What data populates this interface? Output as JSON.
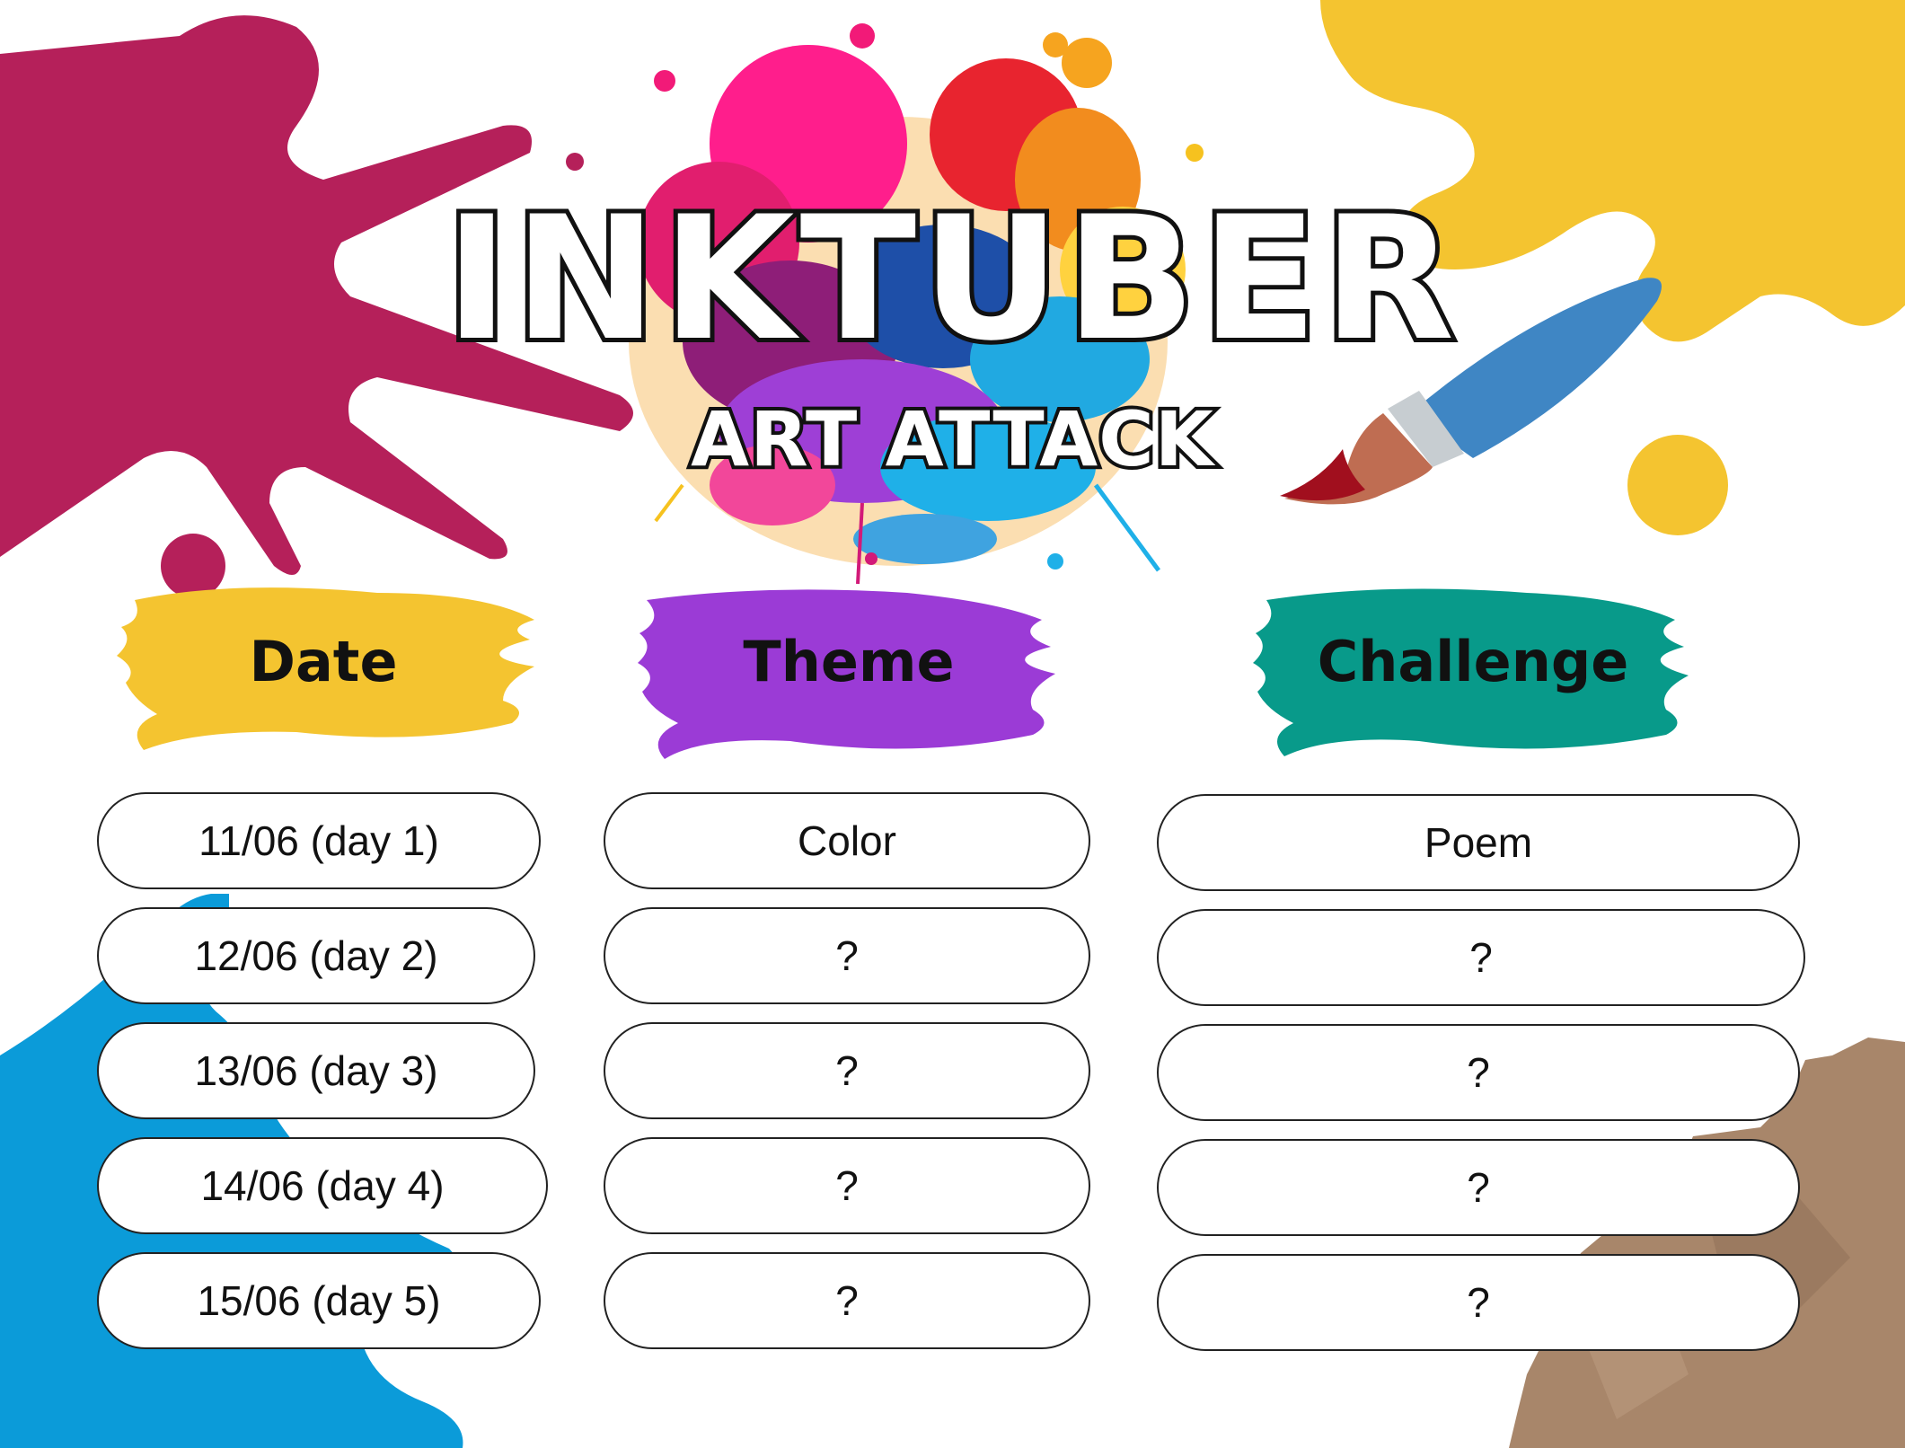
{
  "title": "INKTUBER",
  "subtitle": "ART ATTACK",
  "headers": {
    "date": "Date",
    "theme": "Theme",
    "challenge": "Challenge"
  },
  "colors": {
    "magenta": "#B5205A",
    "yellow": "#F4C430",
    "blue": "#0B9BD9",
    "kraft": "#A8866A",
    "purple": "#9B3BD6",
    "teal": "#089A8A",
    "brush_handle": "#3F86C4",
    "brush_tip": "#A10F1E"
  },
  "rows": [
    {
      "date": "11/06 (day 1)",
      "theme": "Color",
      "challenge": "Poem"
    },
    {
      "date": "12/06 (day 2)",
      "theme": "?",
      "challenge": "?"
    },
    {
      "date": "13/06 (day 3)",
      "theme": "?",
      "challenge": "?"
    },
    {
      "date": "14/06 (day 4)",
      "theme": "?",
      "challenge": "?"
    },
    {
      "date": "15/06 (day 5)",
      "theme": "?",
      "challenge": "?"
    }
  ]
}
